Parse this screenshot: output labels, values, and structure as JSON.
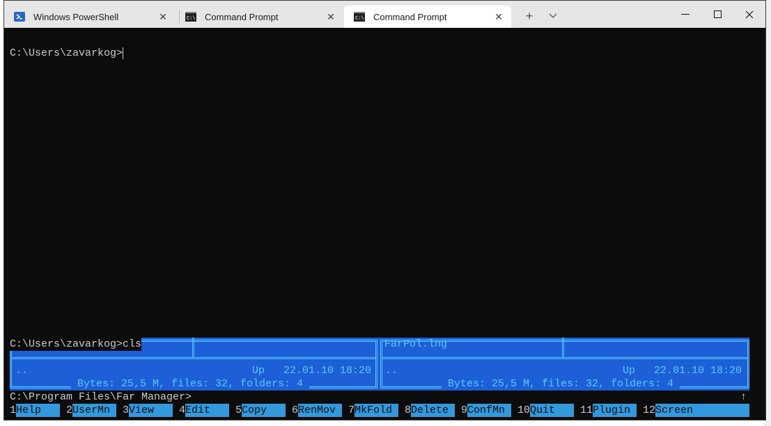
{
  "tabs": [
    {
      "label": "Windows PowerShell",
      "icon": "powershell-icon",
      "active": false
    },
    {
      "label": "Command Prompt",
      "icon": "cmd-icon",
      "active": false
    },
    {
      "label": "Command Prompt",
      "icon": "cmd-icon",
      "active": true
    }
  ],
  "titlebar": {
    "new_tab": "+",
    "dropdown": "⌄",
    "minimize": "—",
    "maximize": "☐",
    "close": "✕"
  },
  "terminal": {
    "prompt_line": "C:\\Users\\zavarkog>",
    "cls_line": "C:\\Users\\zavarkog>cls",
    "left_panel": {
      "parent_dir": "..",
      "date_info": "Up   22.01.10 18:20",
      "summary": " Bytes: 25,5 M, files: 32, folders: 4 "
    },
    "right_panel": {
      "file": "FarPol.lng",
      "parent_dir": "..",
      "date_info": "Up   22.01.10 18:20",
      "summary": " Bytes: 25,5 M, files: 32, folders: 4 "
    },
    "command_line": "C:\\Program Files\\Far Manager>",
    "scroll_arrow": "↑"
  },
  "keybar": [
    {
      "num": "1",
      "label": "Help"
    },
    {
      "num": "2",
      "label": "UserMn"
    },
    {
      "num": "3",
      "label": "View"
    },
    {
      "num": "4",
      "label": "Edit"
    },
    {
      "num": "5",
      "label": "Copy"
    },
    {
      "num": "6",
      "label": "RenMov"
    },
    {
      "num": "7",
      "label": "MkFold"
    },
    {
      "num": "8",
      "label": "Delete"
    },
    {
      "num": "9",
      "label": "ConfMn"
    },
    {
      "num": "10",
      "label": "Quit"
    },
    {
      "num": "11",
      "label": "Plugin"
    },
    {
      "num": "12",
      "label": "Screen"
    }
  ],
  "colors": {
    "terminal_bg": "#0c0c0c",
    "panel_bg": "#1c5fd6",
    "panel_fg": "#5ac8ff",
    "keybar_bg": "#3399dd"
  }
}
